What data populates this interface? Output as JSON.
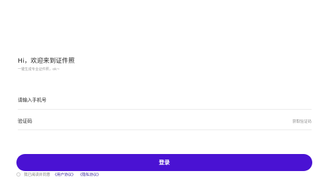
{
  "welcome": {
    "title": "Hi，欢迎来到证件照",
    "subtitle": "一键生成专业证件照，ok~"
  },
  "login_form": {
    "phone_placeholder": "请输入手机号",
    "code_placeholder": "验证码",
    "get_code_label": "获取验证码",
    "login_button_label": "登录"
  },
  "agreement": {
    "text": "我已阅读并同意",
    "user_agreement_label": "《用户协议》",
    "privacy_policy_label": "《隐私协议》"
  },
  "colors": {
    "primary": "#4a12d3",
    "link": "#3b2a9c",
    "divider": "#ececec"
  }
}
